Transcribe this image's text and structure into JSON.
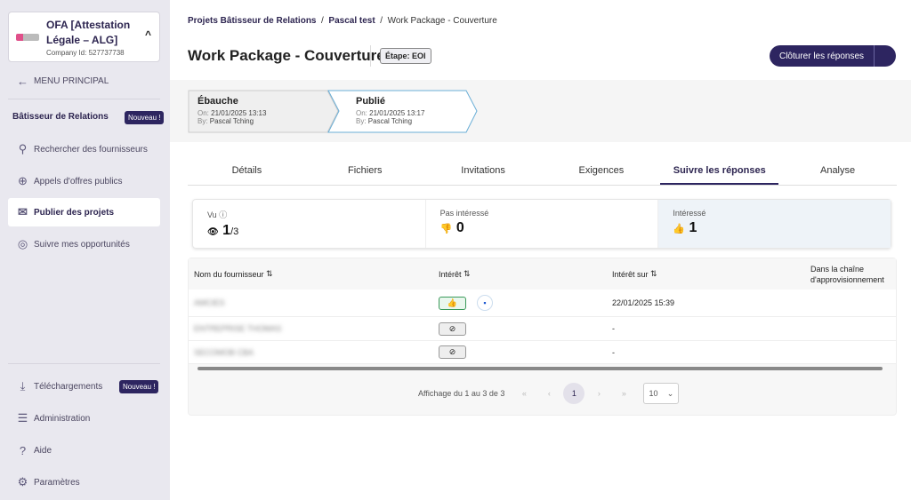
{
  "sidebar": {
    "company_name": "OFA [Attestation Légale – ALG]",
    "company_id": "Company Id: 527737738",
    "back": "MENU PRINCIPAL",
    "section": "Bâtisseur de Relations",
    "new_badge": "Nouveau !",
    "items": [
      {
        "label": "Rechercher des fournisseurs"
      },
      {
        "label": "Appels d'offres publics"
      },
      {
        "label": "Publier des projets"
      },
      {
        "label": "Suivre mes opportunités"
      }
    ],
    "bottom": [
      {
        "label": "Téléchargements",
        "badge": "Nouveau !"
      },
      {
        "label": "Administration"
      },
      {
        "label": "Aide"
      },
      {
        "label": "Paramètres"
      }
    ]
  },
  "breadcrumb": [
    "Projets Bâtisseur de Relations",
    "Pascal test",
    "Work Package - Couverture"
  ],
  "title": "Work Package - Couverture",
  "stage": "Étape: EOI",
  "close_button": "Clôturer les réponses",
  "steps": [
    {
      "name": "Ébauche",
      "on_label": "On:",
      "on": "21/01/2025 13:13",
      "by_label": "By:",
      "by": "Pascal Tching"
    },
    {
      "name": "Publié",
      "on_label": "On:",
      "on": "21/01/2025 13:17",
      "by_label": "By:",
      "by": "Pascal Tching"
    }
  ],
  "tabs": [
    "Détails",
    "Fichiers",
    "Invitations",
    "Exigences",
    "Suivre les réponses",
    "Analyse"
  ],
  "stats": {
    "seen_label": "Vu",
    "seen": "1",
    "seen_total": "/3",
    "not_interested_label": "Pas intéressé",
    "not_interested": "0",
    "interested_label": "Intéressé",
    "interested": "1"
  },
  "table": {
    "headers": [
      "Nom du fournisseur",
      "Intérêt",
      "Intérêt sur",
      "Dans la chaîne d'approvisionnement"
    ],
    "rows": [
      {
        "name": "AMCIES",
        "date": "22/01/2025 15:39"
      },
      {
        "name": "ENTREPRISE THOMAS",
        "date": "-"
      },
      {
        "name": "SECOMOB CBA",
        "date": "-"
      }
    ]
  },
  "pagination": {
    "summary": "Affichage du 1 au 3 de 3",
    "page": "1",
    "page_size": "10"
  }
}
